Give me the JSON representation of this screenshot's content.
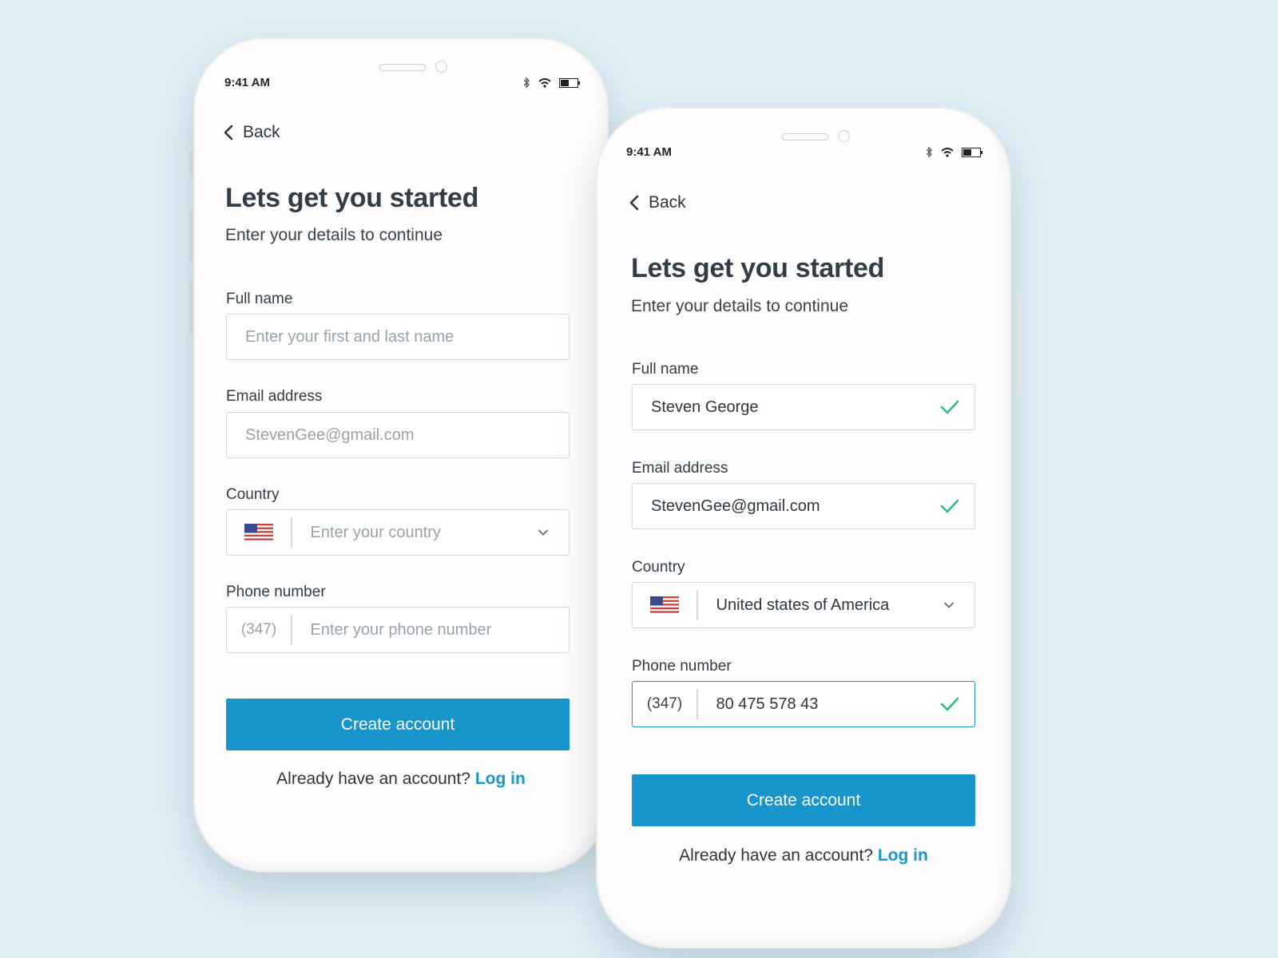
{
  "colors": {
    "background": "#e0eff6",
    "accent": "#1896cb",
    "success": "#2bbd8e",
    "border": "#d3dbe1"
  },
  "phone_empty": {
    "status_time": "9:41 AM",
    "back_label": "Back",
    "title": "Lets get you started",
    "subtitle": "Enter your details to continue",
    "full_name": {
      "label": "Full name",
      "placeholder": "Enter your first and last name"
    },
    "email": {
      "label": "Email address",
      "placeholder": "StevenGee@gmail.com"
    },
    "country": {
      "label": "Country",
      "placeholder": "Enter your country",
      "flag_icon": "us-flag-icon"
    },
    "phone": {
      "label": "Phone number",
      "prefix": "(347)",
      "placeholder": "Enter your phone number"
    },
    "button_label": "Create account",
    "footer_text": "Already have an account?",
    "login_label": "Log in"
  },
  "phone_filled": {
    "status_time": "9:41 AM",
    "back_label": "Back",
    "title": "Lets get you started",
    "subtitle": "Enter your details to continue",
    "full_name": {
      "label": "Full name",
      "value": "Steven George"
    },
    "email": {
      "label": "Email address",
      "value": "StevenGee@gmail.com"
    },
    "country": {
      "label": "Country",
      "value": "United states of America",
      "flag_icon": "us-flag-icon"
    },
    "phone": {
      "label": "Phone number",
      "prefix": "(347)",
      "value": "80 475 578 43"
    },
    "button_label": "Create account",
    "footer_text": "Already have an account?",
    "login_label": "Log in"
  }
}
